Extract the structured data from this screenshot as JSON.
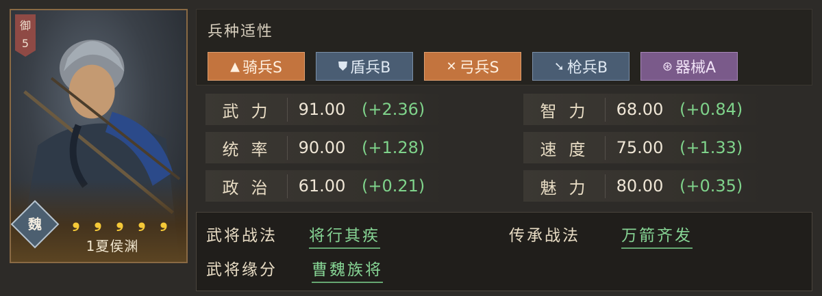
{
  "general": {
    "rank_label": "御",
    "rank_level": "5",
    "kingdom": "魏",
    "stars": [
      "❾",
      "❾",
      "❾",
      "❾",
      "❾"
    ],
    "name": "1夏侯渊"
  },
  "suitability": {
    "title": "兵种适性",
    "troops": [
      {
        "label": "骑兵S",
        "icon": "horse-icon"
      },
      {
        "label": "盾兵B",
        "icon": "shield-icon"
      },
      {
        "label": "弓兵S",
        "icon": "bow-icon"
      },
      {
        "label": "枪兵B",
        "icon": "spear-icon"
      },
      {
        "label": "器械A",
        "icon": "wheel-icon"
      }
    ]
  },
  "stats": [
    {
      "label": "武力",
      "value": "91.00",
      "bonus": "(+2.36)"
    },
    {
      "label": "智力",
      "value": "68.00",
      "bonus": "(+0.84)"
    },
    {
      "label": "统率",
      "value": "90.00",
      "bonus": "(+1.28)"
    },
    {
      "label": "速度",
      "value": "75.00",
      "bonus": "(+1.33)"
    },
    {
      "label": "政治",
      "value": "61.00",
      "bonus": "(+0.21)"
    },
    {
      "label": "魅力",
      "value": "80.00",
      "bonus": "(+0.35)"
    }
  ],
  "skills": {
    "general_tactic_label": "武将战法",
    "general_tactic": "将行其疾",
    "inherit_tactic_label": "传承战法",
    "inherit_tactic": "万箭齐发",
    "bond_label": "武将缘分",
    "bond": "曹魏族将"
  }
}
